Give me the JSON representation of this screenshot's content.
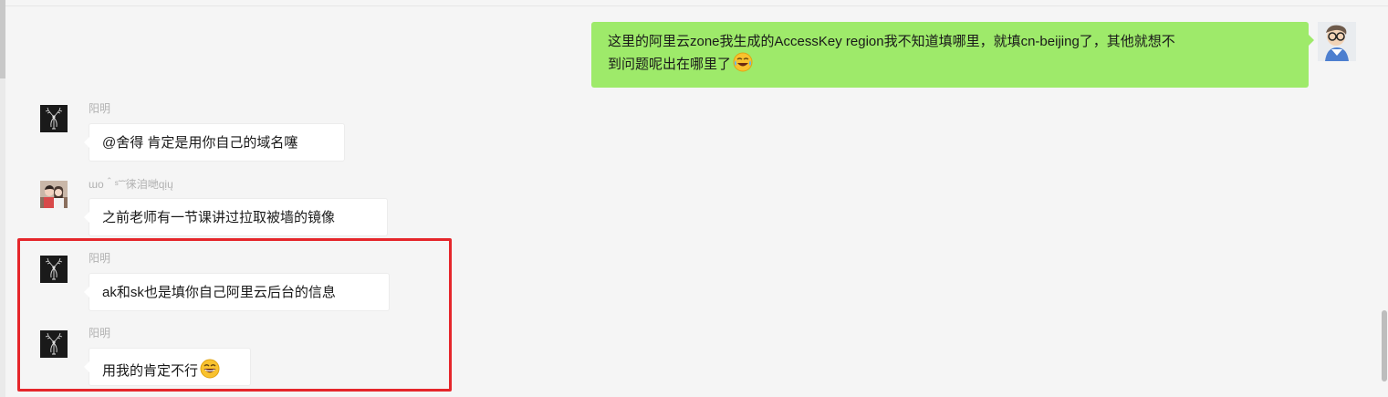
{
  "messages": [
    {
      "side": "right",
      "sender": "",
      "text_line1": "这里的阿里云zone我生成的AccessKey region我不知道填哪里，就填cn-beijing了，其他就想不",
      "text_line2": "到问题呢出在哪里了",
      "emoji": "crying-laughing-emoji",
      "avatar": "cartoon-avatar"
    },
    {
      "side": "left",
      "sender": "阳明",
      "text": "@舍得 肯定是用你自己的域名噻",
      "avatar": "deer-avatar"
    },
    {
      "side": "left",
      "sender": "ɯo＾ˢ˜˜徕洎哋qịų",
      "text": "之前老师有一节课讲过拉取被墙的镜像",
      "avatar": "couple-avatar"
    },
    {
      "side": "left",
      "sender": "阳明",
      "text": "ak和sk也是填你自己阿里云后台的信息",
      "avatar": "deer-avatar"
    },
    {
      "side": "left",
      "sender": "阳明",
      "text": "用我的肯定不行",
      "emoji": "grinning-emoji",
      "avatar": "deer-avatar"
    }
  ],
  "colors": {
    "background": "#f5f5f5",
    "bubble_self": "#9eea6a",
    "bubble_other": "#ffffff",
    "highlight": "#e5262b",
    "sender_name": "#b2b2b2"
  }
}
